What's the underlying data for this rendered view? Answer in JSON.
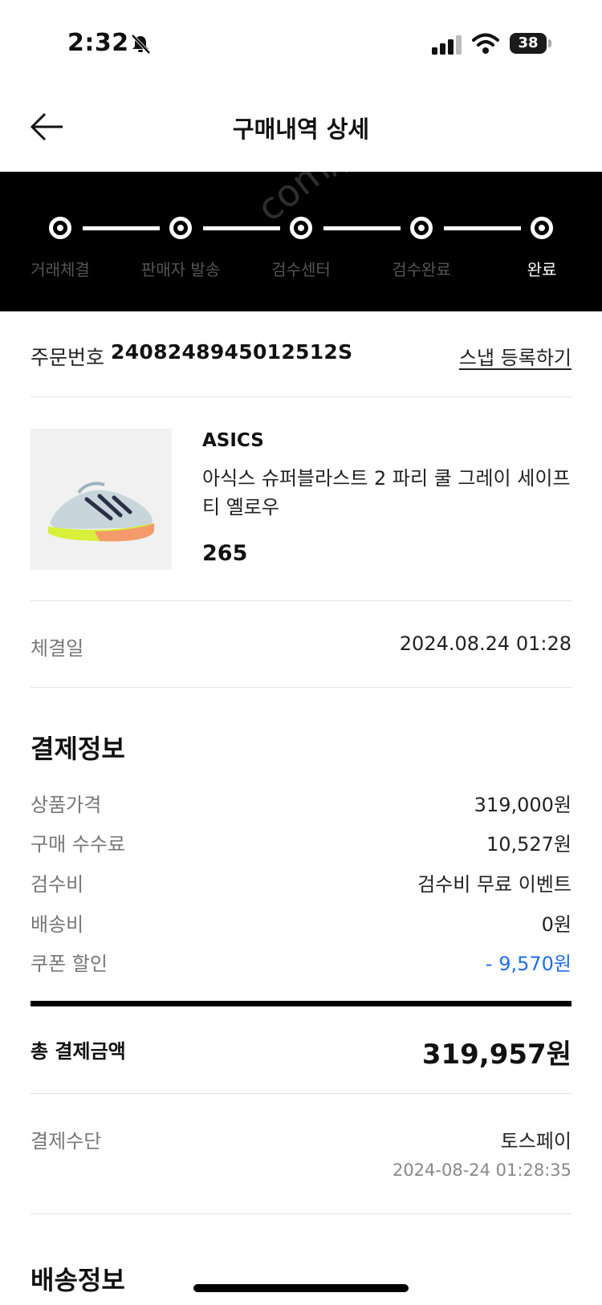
{
  "status_bar": {
    "time": "2:32",
    "battery": "38"
  },
  "header": {
    "title": "구매내역 상세"
  },
  "progress": {
    "steps": [
      "거래체결",
      "판매자 발송",
      "검수센터",
      "검수완료",
      "완료"
    ],
    "current": "완료",
    "watermark": "com/joong"
  },
  "order": {
    "label": "주문번호",
    "number": "2408248945012512S",
    "snap_link": "스냅 등록하기"
  },
  "product": {
    "brand": "ASICS",
    "name": "아식스 슈퍼블라스트 2 파리 쿨 그레이 세이프티 옐로우",
    "size": "265"
  },
  "contract": {
    "label": "체결일",
    "value": "2024.08.24 01:28"
  },
  "payment_info": {
    "title": "결제정보",
    "rows": [
      {
        "label": "상품가격",
        "value": "319,000원"
      },
      {
        "label": "구매 수수료",
        "value": "10,527원"
      },
      {
        "label": "검수비",
        "value": "검수비 무료 이벤트"
      },
      {
        "label": "배송비",
        "value": "0원"
      },
      {
        "label": "쿠폰 할인",
        "value": "- 9,570원"
      }
    ],
    "total_label": "총 결제금액",
    "total_value": "319,957원",
    "method_label": "결제수단",
    "method_value": "토스페이",
    "method_time": "2024-08-24 01:28:35"
  },
  "shipping_info": {
    "title": "배송정보"
  },
  "colors": {
    "accent_blue": "#1e6ef0",
    "progress_bg": "#000000"
  }
}
